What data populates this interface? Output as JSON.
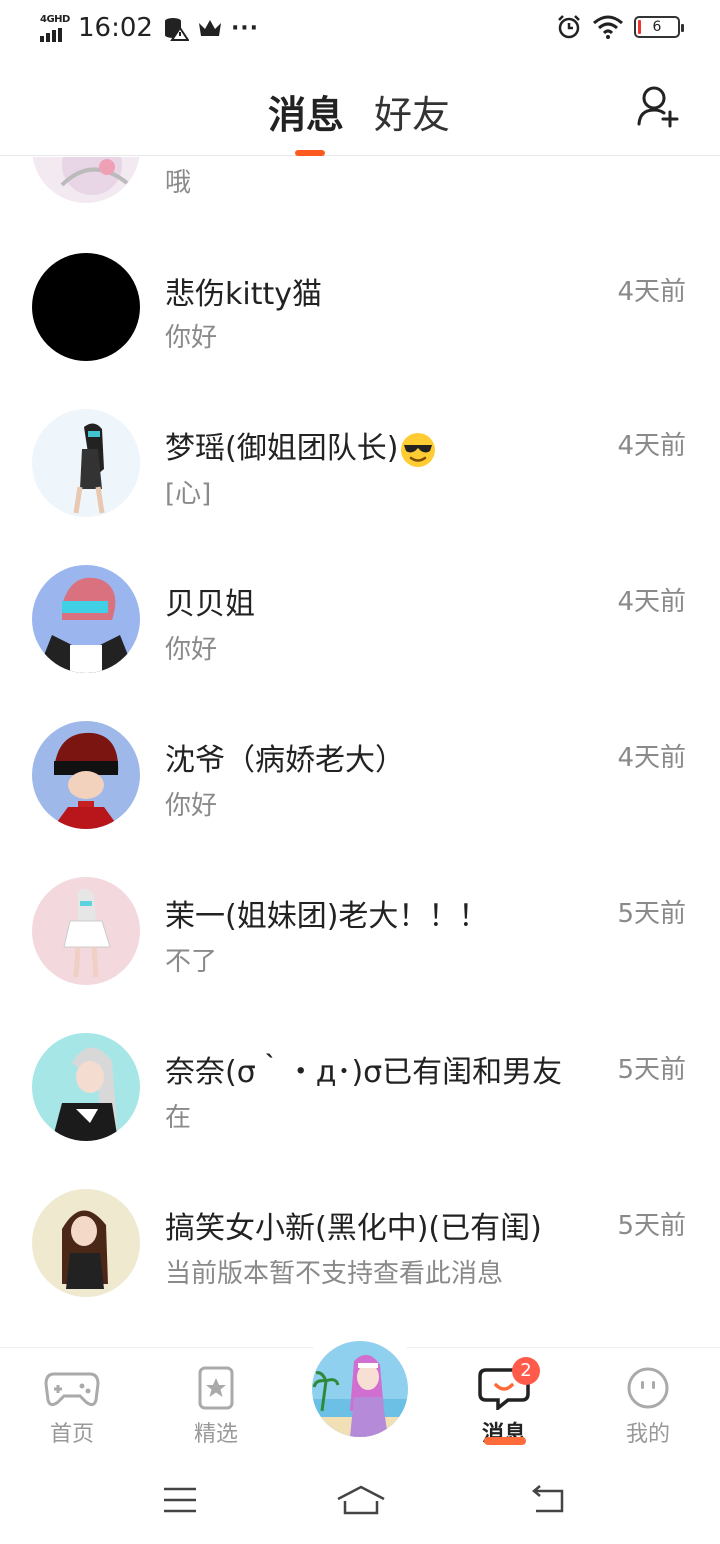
{
  "status_bar": {
    "network_label": "4GHD",
    "time": "16:02",
    "battery": "6",
    "icons": [
      "database-warning-icon",
      "crown-icon",
      "more-dots-icon",
      "alarm-icon",
      "wifi-icon",
      "battery-icon"
    ],
    "more": "···"
  },
  "header": {
    "tab_messages": "消息",
    "tab_friends": "好友",
    "add_friend_icon": "add-user-icon",
    "accent_color": "#ff5a1f"
  },
  "messages": [
    {
      "name": "",
      "preview": "哦",
      "time": ""
    },
    {
      "name": "悲伤kitty猫",
      "preview": "你好",
      "time": "4天前"
    },
    {
      "name": "梦瑶(御姐团队长)",
      "preview": "[心]",
      "time": "4天前",
      "emoji": "sunglasses-emoji"
    },
    {
      "name": "贝贝姐",
      "preview": "你好",
      "time": "4天前"
    },
    {
      "name": "沈爷（病娇老大）",
      "preview": "你好",
      "time": "4天前"
    },
    {
      "name": "茉一(姐妹团)老大！！！",
      "preview": "不了",
      "time": "5天前"
    },
    {
      "name": "奈奈(σ｀・д･)σ已有闺和男友",
      "preview": "在",
      "time": "5天前"
    },
    {
      "name": "搞笑女小新(黑化中)(已有闺)",
      "preview": "当前版本暂不支持查看此消息",
      "time": "5天前"
    }
  ],
  "bottom_nav": {
    "home": "首页",
    "featured": "精选",
    "messages": "消息",
    "mine": "我的",
    "unread_badge": "2"
  }
}
